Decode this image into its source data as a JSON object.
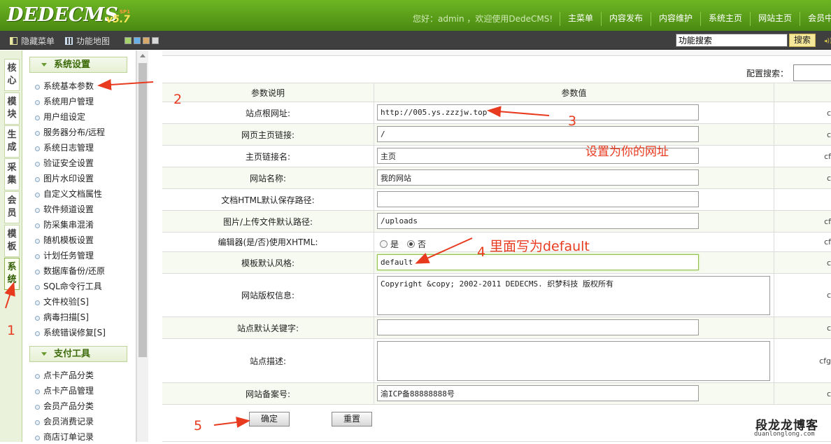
{
  "header": {
    "logo": "DEDECMS",
    "version": "v5.7",
    "edition": "SP1",
    "welcome": "您好：admin ，欢迎使用DedeCMS!",
    "nav": [
      "主菜单",
      "内容发布",
      "内容维护",
      "系统主页",
      "网站主页",
      "会员中"
    ]
  },
  "toolbar": {
    "hide_menu": "隐藏菜单",
    "func_map": "功能地图",
    "search_value": "功能搜索",
    "search_button": "搜索",
    "swatch_colors": [
      "#a6d46a",
      "#6ab0e8",
      "#d8a868",
      "#d8d8d8"
    ]
  },
  "left_tabs": [
    "核心",
    "模块",
    "生成",
    "采集",
    "会员",
    "模板",
    "系统"
  ],
  "menu": {
    "system_title": "系统设置",
    "system_items": [
      "系统基本参数",
      "系统用户管理",
      "用户组设定",
      "服务器分布/远程",
      "系统日志管理",
      "验证安全设置",
      "图片水印设置",
      "自定义文档属性",
      "软件频道设置",
      "防采集串混淆",
      "随机模板设置",
      "计划任务管理",
      "数据库备份/还原",
      "SQL命令行工具",
      "文件校验[S]",
      "病毒扫描[S]",
      "系统错误修复[S]"
    ],
    "pay_title": "支付工具",
    "pay_items": [
      "点卡产品分类",
      "点卡产品管理",
      "会员产品分类",
      "会员消费记录",
      "商店订单记录"
    ]
  },
  "content": {
    "config_search_label": "配置搜索：",
    "header_label": "参数说明",
    "header_value": "参数值",
    "rows": [
      {
        "label": "站点根网址:",
        "value": "http://005.ys.zzzjw.top",
        "var": "c"
      },
      {
        "label": "网页主页链接:",
        "value": "/",
        "var": "c"
      },
      {
        "label": "主页链接名:",
        "value": "主页",
        "var": "cf"
      },
      {
        "label": "网站名称:",
        "value": "我的网站",
        "var": "c"
      },
      {
        "label": "文档HTML默认保存路径:",
        "value": "",
        "var": ""
      },
      {
        "label": "图片/上传文件默认路径:",
        "value": "/uploads",
        "var": "cf"
      },
      {
        "label": "编辑器(是/否)使用XHTML:",
        "value": "",
        "var": "cf",
        "radio_yes": "是",
        "radio_no": "否"
      },
      {
        "label": "模板默认风格:",
        "value": "default",
        "var": "c"
      },
      {
        "label": "网站版权信息:",
        "value": "Copyright &copy; 2002-2011 DEDECMS. 织梦科技 版权所有",
        "var": "c"
      },
      {
        "label": "站点默认关键字:",
        "value": "",
        "var": "c"
      },
      {
        "label": "站点描述:",
        "value": "",
        "var": "cfg"
      },
      {
        "label": "网站备案号:",
        "value": "渝ICP备88888888号",
        "var": "c"
      }
    ],
    "ok_button": "确定",
    "reset_button": "重置"
  },
  "annotations": {
    "n1": "1",
    "n2": "2",
    "n3": "3",
    "n4": "4",
    "n5": "5",
    "set_url": "设置为你的网址",
    "write_default": "里面写为default"
  },
  "watermark": {
    "title": "段龙龙博客",
    "url": "duanlonglong.com"
  }
}
